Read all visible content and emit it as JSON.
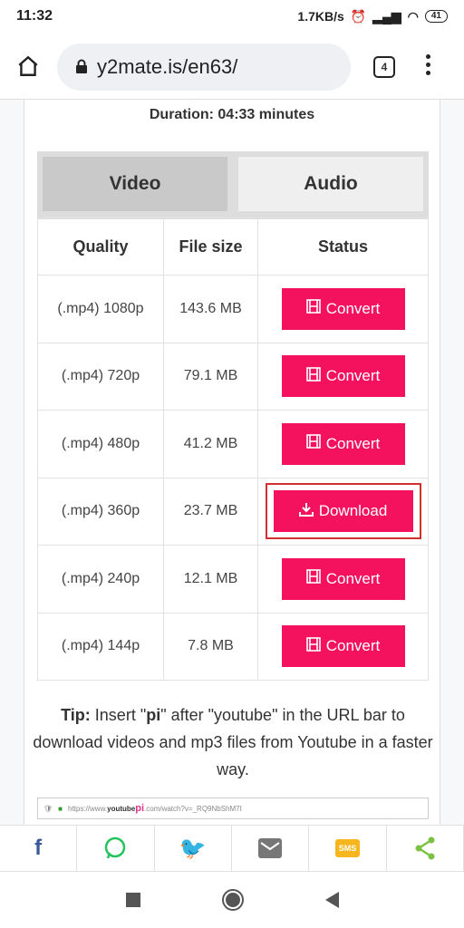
{
  "status_bar": {
    "time": "11:32",
    "net_speed": "1.7KB/s",
    "battery": "41"
  },
  "browser": {
    "url": "y2mate.is/en63/",
    "tab_count": "4"
  },
  "page": {
    "duration": "Duration: 04:33 minutes",
    "tabs": [
      "Video",
      "Audio"
    ],
    "headers": [
      "Quality",
      "File size",
      "Status"
    ],
    "rows": [
      {
        "quality": "(.mp4) 1080p",
        "size": "143.6 MB",
        "action": "Convert"
      },
      {
        "quality": "(.mp4) 720p",
        "size": "79.1 MB",
        "action": "Convert"
      },
      {
        "quality": "(.mp4) 480p",
        "size": "41.2 MB",
        "action": "Convert"
      },
      {
        "quality": "(.mp4) 360p",
        "size": "23.7 MB",
        "action": "Download"
      },
      {
        "quality": "(.mp4) 240p",
        "size": "12.1 MB",
        "action": "Convert"
      },
      {
        "quality": "(.mp4) 144p",
        "size": "7.8 MB",
        "action": "Convert"
      }
    ],
    "tip_label": "Tip:",
    "tip_pre": " Insert \"",
    "tip_bold": "pi",
    "tip_post": "\" after \"youtube\" in the URL bar to download videos and mp3 files from Youtube in a faster way.",
    "example_url_pre": "https://www.",
    "example_url_b": "youtube",
    "example_url_pi": "pi",
    "example_url_post": ".com/watch?v=_RQ9NbShM7I"
  },
  "share": [
    "facebook",
    "whatsapp",
    "twitter",
    "email",
    "sms",
    "share"
  ],
  "colors": {
    "accent": "#f4115e",
    "highlight": "#d32f2f"
  }
}
